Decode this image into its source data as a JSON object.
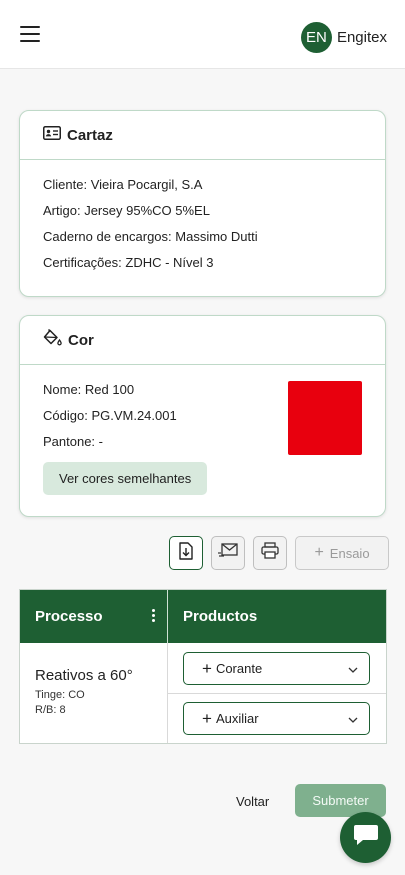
{
  "header": {
    "avatar_initials": "EN",
    "company": "Engitex"
  },
  "cartaz": {
    "title": "Cartaz",
    "fields": [
      {
        "label": "Cliente:",
        "value": "Vieira Pocargil, S.A"
      },
      {
        "label": "Artigo:",
        "value": "Jersey 95%CO 5%EL"
      },
      {
        "label": "Caderno de encargos:",
        "value": "Massimo Dutti"
      },
      {
        "label": "Certificações:",
        "value": " ZDHC - Nível 3"
      }
    ]
  },
  "cor": {
    "title": "Cor",
    "fields": [
      {
        "label": "Nome:",
        "value": "Red 100"
      },
      {
        "label": "Código:",
        "value": "PG.VM.24.001"
      },
      {
        "label": "Pantone:",
        "value": "-"
      }
    ],
    "swatch_color": "#e8000e",
    "similar_button": "Ver cores semelhantes"
  },
  "toolbar": {
    "icons": [
      "download-file-icon",
      "email-icon",
      "print-icon"
    ],
    "ensaio_label": "Ensaio"
  },
  "table": {
    "headers": [
      "Processo",
      "Productos"
    ],
    "process_name": "Reativos a 60°",
    "process_details": [
      "Tinge: CO",
      "R/B: 8"
    ],
    "products": [
      "Corante",
      "Auxiliar"
    ]
  },
  "footer": {
    "back_label": "Voltar",
    "submit_label": "Submeter"
  },
  "colors": {
    "brand_green": "#1e5f33",
    "submit_disabled": "#7fb08e"
  }
}
